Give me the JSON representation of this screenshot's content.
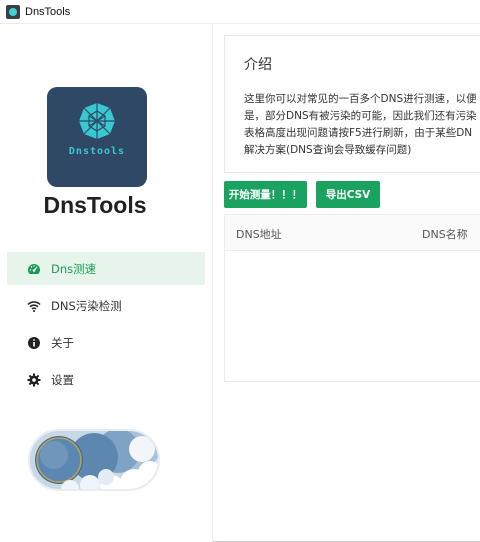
{
  "window": {
    "title": "DnsTools"
  },
  "logo": {
    "text": "Dnstools"
  },
  "brand": "DnsTools",
  "nav": [
    {
      "label": "Dns测速",
      "icon": "speedometer-icon",
      "active": true
    },
    {
      "label": "DNS污染检测",
      "icon": "wifi-icon",
      "active": false
    },
    {
      "label": "关于",
      "icon": "info-icon",
      "active": false
    },
    {
      "label": "设置",
      "icon": "gear-icon",
      "active": false
    }
  ],
  "intro": {
    "title": "介绍",
    "lines": [
      "这里你可以对常见的一百多个DNS进行测速，以便",
      "是，部分DNS有被污染的可能，因此我们还有污染",
      "表格高度出现问题请按F5进行刷新，由于某些DN",
      "解决方案(DNS查询会导致缓存问题)"
    ]
  },
  "buttons": {
    "start": "开始测量！！！",
    "export": "导出CSV"
  },
  "table": {
    "columns": [
      "DNS地址",
      "DNS名称"
    ]
  },
  "colors": {
    "accent": "#1aa260",
    "logo_bg": "#2f4865",
    "logo_fg": "#38c9d0"
  }
}
